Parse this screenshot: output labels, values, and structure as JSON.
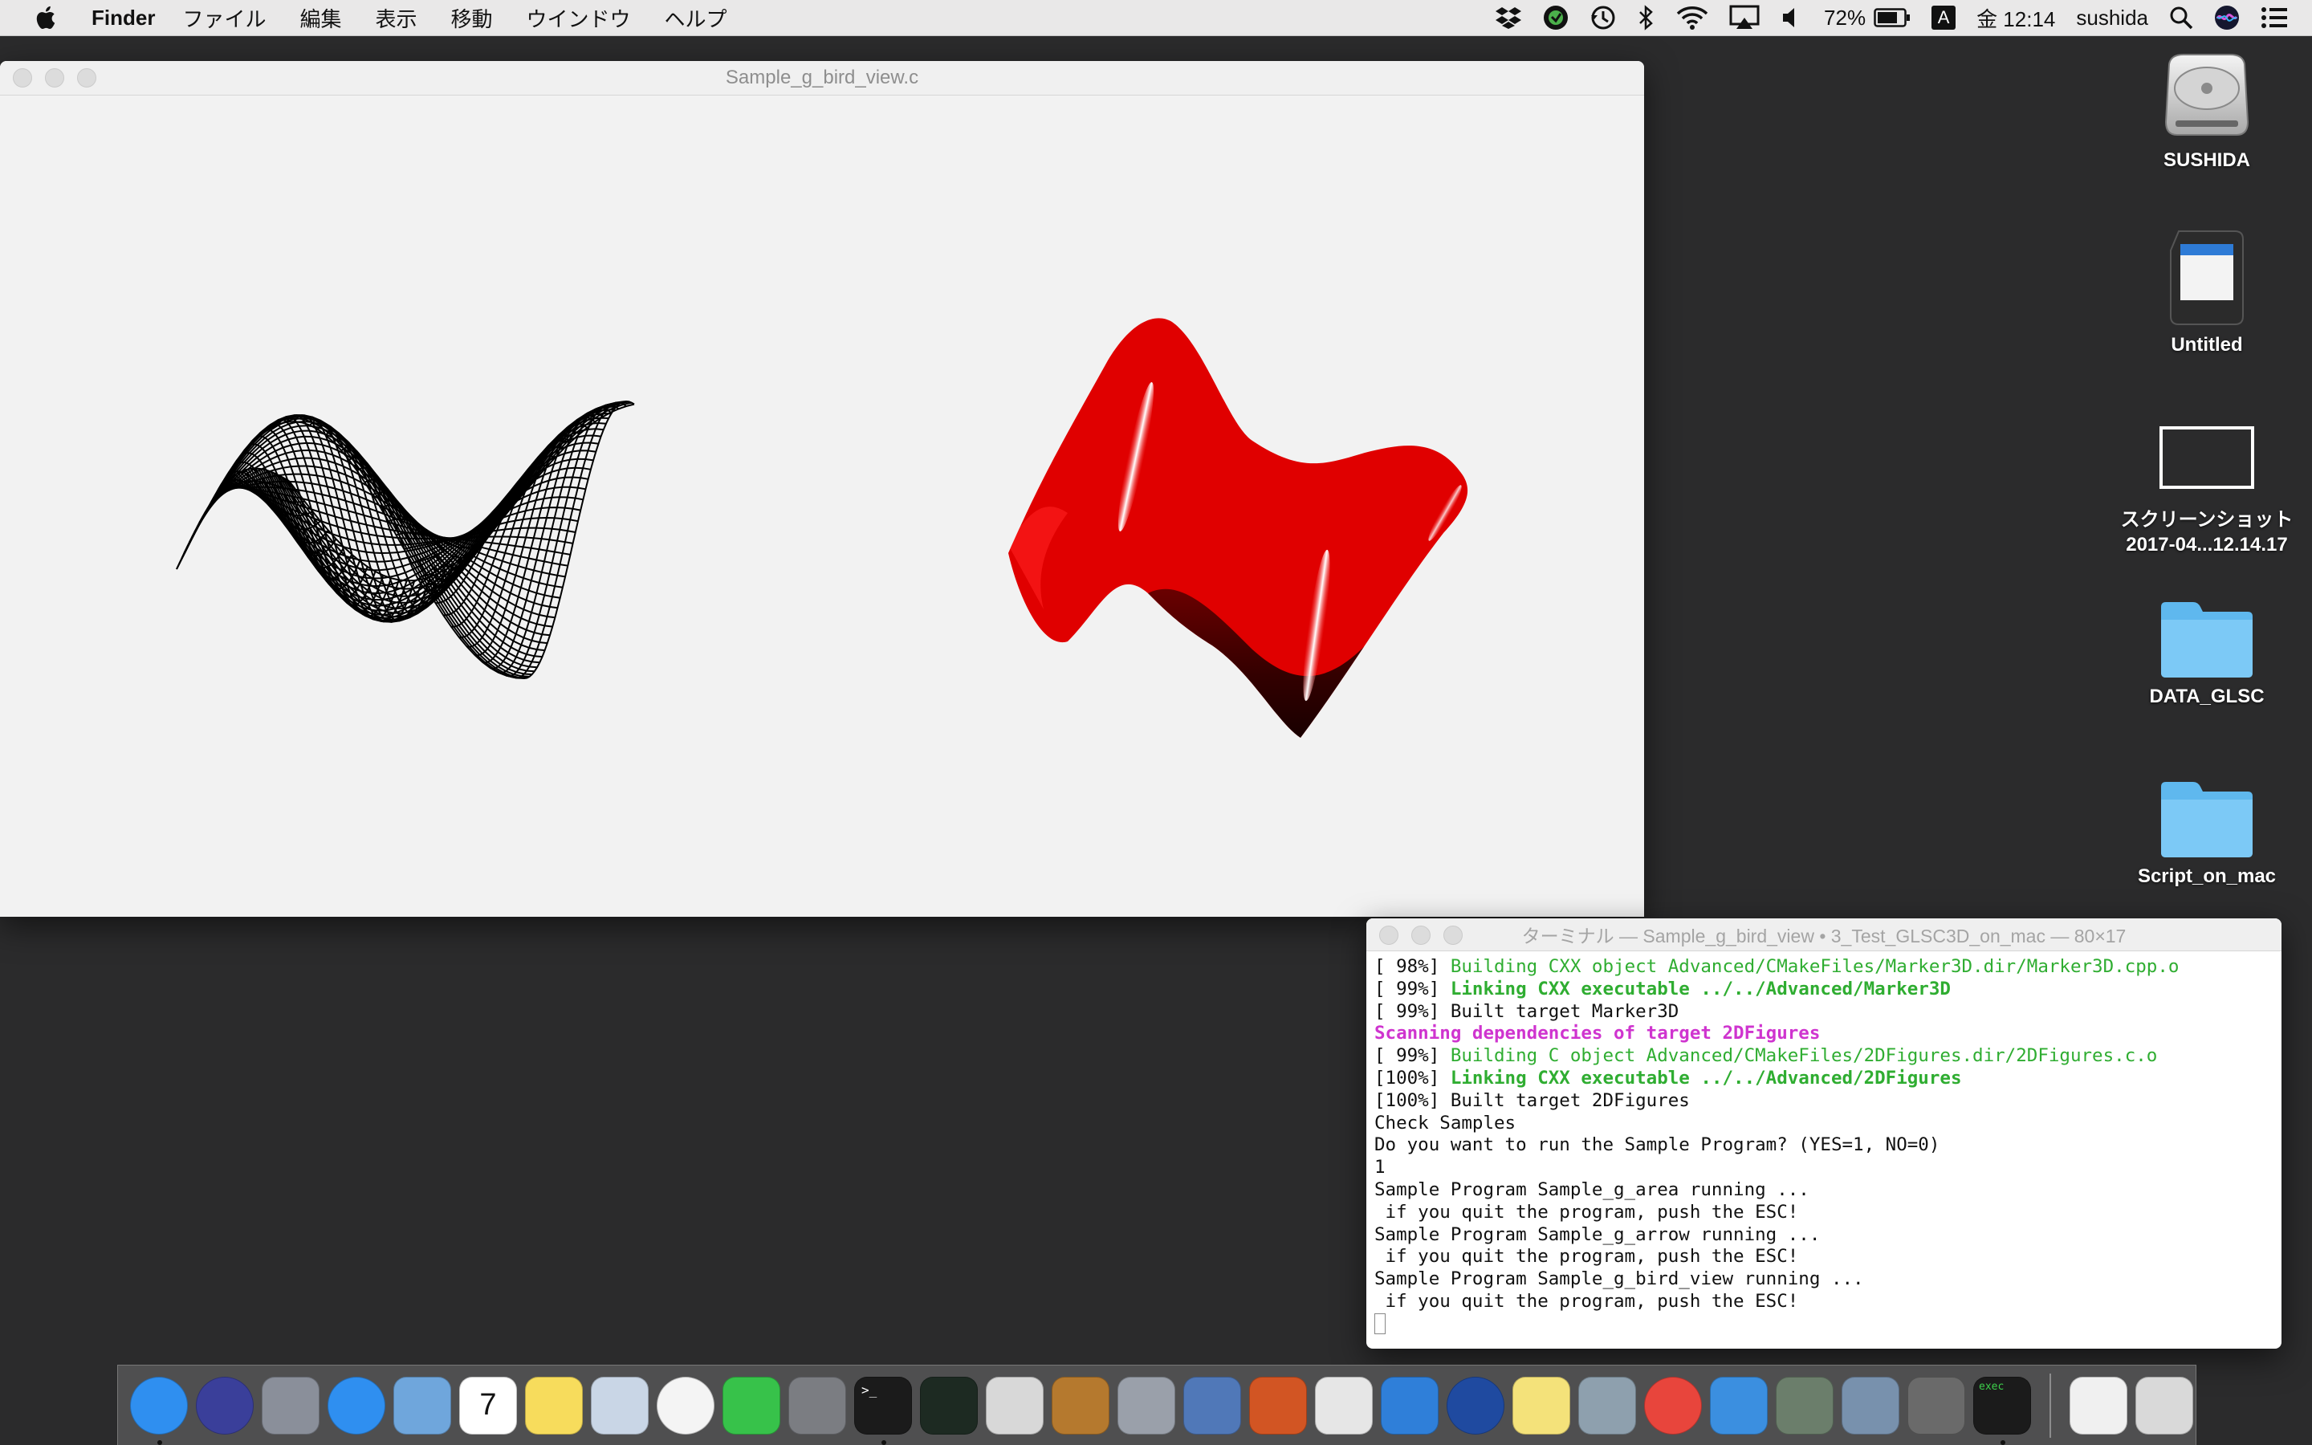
{
  "menubar": {
    "app_name": "Finder",
    "menus": [
      "ファイル",
      "編集",
      "表示",
      "移動",
      "ウインドウ",
      "ヘルプ"
    ],
    "battery_percent": "72%",
    "input_source": "A",
    "clock": "金 12:14",
    "user": "sushida"
  },
  "view_window": {
    "title": "Sample_g_bird_view.c",
    "wireframe_color": "#000000",
    "shaded_color": "#e00000"
  },
  "terminal": {
    "title": "ターミナル — Sample_g_bird_view • 3_Test_GLSC3D_on_mac — 80×17",
    "lines": [
      {
        "prefix": "[ 98%] ",
        "text": "Building CXX object Advanced/CMakeFiles/Marker3D.dir/Marker3D.cpp.o",
        "style": "green"
      },
      {
        "prefix": "[ 99%] ",
        "text": "Linking CXX executable ../../Advanced/Marker3D",
        "style": "green-bold"
      },
      {
        "prefix": "[ 99%] ",
        "text": "Built target Marker3D",
        "style": "plain"
      },
      {
        "prefix": "",
        "text": "Scanning dependencies of target 2DFigures",
        "style": "magenta"
      },
      {
        "prefix": "[ 99%] ",
        "text": "Building C object Advanced/CMakeFiles/2DFigures.dir/2DFigures.c.o",
        "style": "green"
      },
      {
        "prefix": "[100%] ",
        "text": "Linking CXX executable ../../Advanced/2DFigures",
        "style": "green-bold"
      },
      {
        "prefix": "[100%] ",
        "text": "Built target 2DFigures",
        "style": "plain"
      },
      {
        "prefix": "",
        "text": "Check Samples",
        "style": "plain"
      },
      {
        "prefix": "",
        "text": "Do you want to run the Sample Program? (YES=1, NO=0)",
        "style": "plain"
      },
      {
        "prefix": "",
        "text": "1",
        "style": "plain"
      },
      {
        "prefix": "",
        "text": "Sample Program Sample_g_area running ...",
        "style": "plain"
      },
      {
        "prefix": "",
        "text": " if you quit the program, push the ESC!",
        "style": "plain"
      },
      {
        "prefix": "",
        "text": "Sample Program Sample_g_arrow running ...",
        "style": "plain"
      },
      {
        "prefix": "",
        "text": " if you quit the program, push the ESC!",
        "style": "plain"
      },
      {
        "prefix": "",
        "text": "Sample Program Sample_g_bird_view running ...",
        "style": "plain"
      },
      {
        "prefix": "",
        "text": " if you quit the program, push the ESC!",
        "style": "plain"
      }
    ]
  },
  "desktop": {
    "icons": [
      {
        "label": "SUSHIDA",
        "kind": "hard-drive-icon"
      },
      {
        "label": "Untitled",
        "kind": "sd-card-icon"
      },
      {
        "label": "スクリーンショット",
        "label2": "2017-04...12.14.17",
        "kind": "screenshot-icon"
      },
      {
        "label": "DATA_GLSC",
        "kind": "folder-icon"
      },
      {
        "label": "Script_on_mac",
        "kind": "folder-icon"
      }
    ]
  },
  "dock": {
    "apps": [
      {
        "name": "finder-icon",
        "color": "#2f8ff0",
        "running": true
      },
      {
        "name": "siri-icon",
        "color": "#3a3f9a",
        "running": false
      },
      {
        "name": "launchpad-icon",
        "color": "#8a8f9a",
        "running": false
      },
      {
        "name": "safari-icon",
        "color": "#2f8ff0",
        "running": false
      },
      {
        "name": "mail-icon",
        "color": "#6fa6dc",
        "running": false
      },
      {
        "name": "calendar-icon",
        "color": "#ffffff",
        "running": false
      },
      {
        "name": "notes-icon",
        "color": "#f7dc5c",
        "running": false
      },
      {
        "name": "preview-icon",
        "color": "#c9d6e6",
        "running": false
      },
      {
        "name": "photos-icon",
        "color": "#f4f4f4",
        "running": false
      },
      {
        "name": "facetime-icon",
        "color": "#37c24a",
        "running": false
      },
      {
        "name": "system-preferences-icon",
        "color": "#7b7d82",
        "running": false
      },
      {
        "name": "terminal-icon",
        "color": "#1b1b1b",
        "running": true
      },
      {
        "name": "activity-monitor-icon",
        "color": "#1d2a22",
        "running": false
      },
      {
        "name": "x11-icon",
        "color": "#d8d8d8",
        "running": false
      },
      {
        "name": "keynote-icon",
        "color": "#b5792e",
        "running": false
      },
      {
        "name": "script-editor-icon",
        "color": "#9aa0aa",
        "running": false
      },
      {
        "name": "grapher-icon",
        "color": "#5078b8",
        "running": false
      },
      {
        "name": "mathematica-icon",
        "color": "#d25523",
        "running": false
      },
      {
        "name": "latexit-icon",
        "color": "#e6e6e6",
        "running": false
      },
      {
        "name": "keynote-podium-icon",
        "color": "#2f7fd9",
        "running": false
      },
      {
        "name": "quicktime-icon",
        "color": "#1f4aa0",
        "running": false
      },
      {
        "name": "stickies-icon",
        "color": "#f4e27a",
        "running": false
      },
      {
        "name": "texshop-icon",
        "color": "#8ea0ae",
        "running": false
      },
      {
        "name": "chrome-icon",
        "color": "#e8453c",
        "running": false
      },
      {
        "name": "xcode-icon",
        "color": "#3b8fe0",
        "running": false
      },
      {
        "name": "eye-icon",
        "color": "#6b7e6b",
        "running": false
      },
      {
        "name": "image-capture-icon",
        "color": "#7891ad",
        "running": false
      },
      {
        "name": "sushida-app-icon",
        "color": "#6a6a6a",
        "running": false
      },
      {
        "name": "exec-terminal-icon",
        "color": "#1b1b1b",
        "running": true,
        "caption": "exec"
      }
    ],
    "trailing": [
      {
        "name": "zip-file-icon",
        "color": "#f0f0f0"
      },
      {
        "name": "trash-icon",
        "color": "#d9d9d9"
      }
    ]
  }
}
